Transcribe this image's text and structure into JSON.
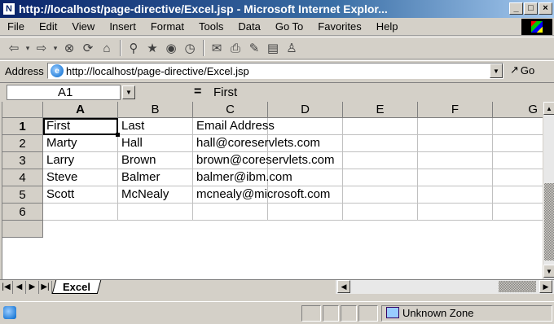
{
  "window": {
    "title": "http://localhost/page-directive/Excel.jsp - Microsoft Internet Explor...",
    "title_icon": "N",
    "buttons": {
      "minimize": "_",
      "maximize": "□",
      "close": "×"
    }
  },
  "menu": [
    "File",
    "Edit",
    "View",
    "Insert",
    "Format",
    "Tools",
    "Data",
    "Go To",
    "Favorites",
    "Help"
  ],
  "toolbar_icons": [
    "back-arrow-icon",
    "forward-arrow-icon",
    "stop-icon",
    "refresh-icon",
    "home-icon",
    "search-icon",
    "favorites-icon",
    "history-icon",
    "mail-icon",
    "print-icon",
    "edit-icon",
    "discuss-icon",
    "messenger-icon"
  ],
  "address": {
    "label": "Address",
    "url": "http://localhost/page-directive/Excel.jsp",
    "go_label": "Go"
  },
  "formula_bar": {
    "name_box": "A1",
    "equals": "=",
    "value": "First"
  },
  "sheet": {
    "columns": [
      "A",
      "B",
      "C",
      "D",
      "E",
      "F",
      "G"
    ],
    "rows": [
      {
        "num": "1",
        "cells": [
          "First",
          "Last",
          "Email Address"
        ]
      },
      {
        "num": "2",
        "cells": [
          "Marty",
          "Hall",
          "hall@coreservlets.com"
        ]
      },
      {
        "num": "3",
        "cells": [
          "Larry",
          "Brown",
          "brown@coreservlets.com"
        ]
      },
      {
        "num": "4",
        "cells": [
          "Steve",
          "Balmer",
          "balmer@ibm.com"
        ]
      },
      {
        "num": "5",
        "cells": [
          "Scott",
          "McNealy",
          "mcnealy@microsoft.com"
        ]
      },
      {
        "num": "6",
        "cells": [
          "",
          "",
          ""
        ]
      }
    ],
    "active_tab": "Excel"
  },
  "status": {
    "zone": "Unknown Zone"
  }
}
